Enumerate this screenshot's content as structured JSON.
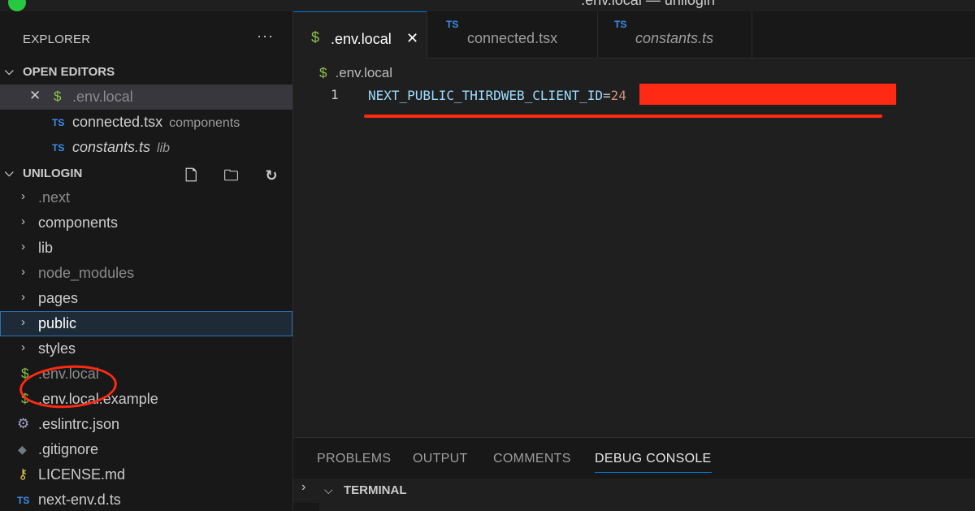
{
  "window": {
    "title": ".env.local — unilogin"
  },
  "explorer": {
    "header": "EXPLORER",
    "more": "···",
    "open_editors": {
      "label": "OPEN EDITORS",
      "items": [
        {
          "icon": "$",
          "name": ".env.local",
          "hint": ""
        },
        {
          "icon": "TS",
          "name": "connected.tsx",
          "hint": "components"
        },
        {
          "icon": "TS",
          "name": "constants.ts",
          "hint": "lib"
        }
      ]
    },
    "project": {
      "label": "UNILOGIN",
      "toolbar": "🗋 🗀 ↻ ⊟",
      "folders": [
        ".next",
        "components",
        "lib",
        "node_modules",
        "pages",
        "public",
        "styles"
      ],
      "files": [
        {
          "icon": "$",
          "name": ".env.local"
        },
        {
          "icon": "$",
          "name": ".env.local.example"
        },
        {
          "icon": "⚙",
          "name": ".eslintrc.json"
        },
        {
          "icon": "◆",
          "name": ".gitignore"
        },
        {
          "icon": "⚷",
          "name": "LICENSE.md"
        },
        {
          "icon": "TS",
          "name": "next-env.d.ts"
        }
      ]
    }
  },
  "tabs": [
    {
      "icon": "$",
      "label": ".env.local",
      "close": "✕"
    },
    {
      "icon": "TS",
      "label": "connected.tsx"
    },
    {
      "icon": "TS",
      "label": "constants.ts"
    }
  ],
  "breadcrumb": {
    "icon": "$",
    "label": ".env.local"
  },
  "editor": {
    "line_number": "1",
    "key": "NEXT_PUBLIC_THIRDWEB_CLIENT_ID",
    "eq": "=",
    "value": "24"
  },
  "panel": {
    "tabs": [
      "PROBLEMS",
      "OUTPUT",
      "COMMENTS",
      "DEBUG CONSOLE"
    ],
    "active_tab": "DEBUG CONSOLE",
    "terminal_label": "TERMINAL"
  },
  "colors": {
    "accent": "#0078d4",
    "annotation_red": "#ff2a14",
    "env_icon": "#8bc34a",
    "ts_icon": "#3b8eea"
  }
}
